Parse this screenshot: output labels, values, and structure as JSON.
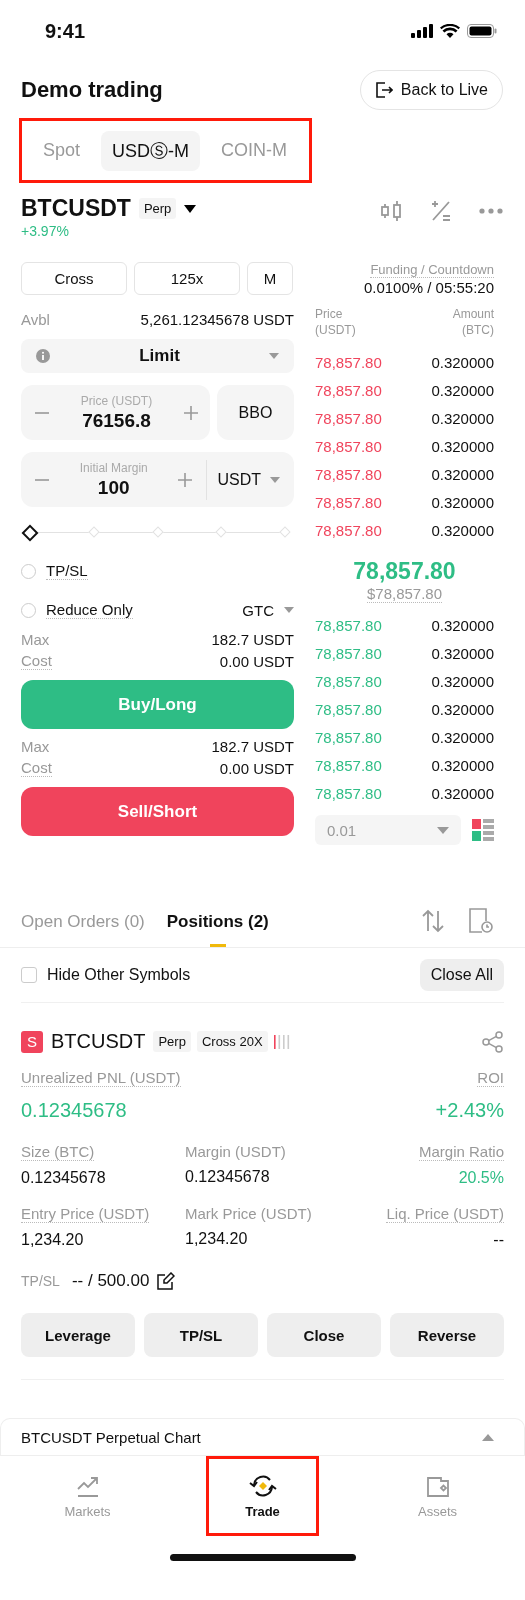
{
  "status_bar": {
    "time": "9:41"
  },
  "header": {
    "title": "Demo trading",
    "back_button": "Back to Live"
  },
  "market_tabs": {
    "highlighted": true,
    "items": [
      {
        "label": "Spot",
        "selected": false
      },
      {
        "label": "USDⓈ-M",
        "selected": true
      },
      {
        "label": "COIN-M",
        "selected": false
      }
    ]
  },
  "symbol": {
    "name": "BTCUSDT",
    "tag": "Perp",
    "change": "+3.97%"
  },
  "order_form": {
    "margin_mode": "Cross",
    "leverage": "125x",
    "asset_mode": "M",
    "avbl_label": "Avbl",
    "avbl_value": "5,261.12345678 USDT",
    "order_type": "Limit",
    "price_field": {
      "label": "Price (USDT)",
      "value": "76156.8"
    },
    "bbo": "BBO",
    "margin_field": {
      "label": "Initial Margin",
      "value": "100",
      "unit": "USDT"
    },
    "slider": {
      "level": 0
    },
    "options": [
      {
        "label": "TP/SL",
        "checked": false
      },
      {
        "label": "Reduce Only",
        "checked": false
      }
    ],
    "time_in_force": "GTC",
    "buy": {
      "max_label": "Max",
      "max_value": "182.7 USDT",
      "cost_label": "Cost",
      "cost_value": "0.00 USDT",
      "button": "Buy/Long"
    },
    "sell": {
      "max_label": "Max",
      "max_value": "182.7 USDT",
      "cost_label": "Cost",
      "cost_value": "0.00 USDT",
      "button": "Sell/Short"
    }
  },
  "order_book": {
    "funding_label": "Funding / Countdown",
    "funding_value": "0.0100% / 05:55:20",
    "price_header": "Price (USDT)",
    "amount_header": "Amount (BTC)",
    "asks": [
      {
        "price": "78,857.80",
        "amount": "0.320000"
      },
      {
        "price": "78,857.80",
        "amount": "0.320000"
      },
      {
        "price": "78,857.80",
        "amount": "0.320000"
      },
      {
        "price": "78,857.80",
        "amount": "0.320000"
      },
      {
        "price": "78,857.80",
        "amount": "0.320000"
      },
      {
        "price": "78,857.80",
        "amount": "0.320000"
      },
      {
        "price": "78,857.80",
        "amount": "0.320000"
      }
    ],
    "last_price": "78,857.80",
    "mark_price": "$78,857.80",
    "bids": [
      {
        "price": "78,857.80",
        "amount": "0.320000"
      },
      {
        "price": "78,857.80",
        "amount": "0.320000"
      },
      {
        "price": "78,857.80",
        "amount": "0.320000"
      },
      {
        "price": "78,857.80",
        "amount": "0.320000"
      },
      {
        "price": "78,857.80",
        "amount": "0.320000"
      },
      {
        "price": "78,857.80",
        "amount": "0.320000"
      },
      {
        "price": "78,857.80",
        "amount": "0.320000"
      }
    ],
    "depth": "0.01"
  },
  "orders_tabs": [
    {
      "label": "Open Orders (0)",
      "selected": false
    },
    {
      "label": "Positions (2)",
      "selected": true
    }
  ],
  "filter": {
    "label": "Hide Other Symbols",
    "checked": false,
    "close_all": "Close All"
  },
  "position": {
    "side": "S",
    "symbol": "BTCUSDT",
    "tags": [
      "Perp",
      "Cross 20X"
    ],
    "pnl_label": "Unrealized PNL (USDT)",
    "pnl_value": "0.12345678",
    "roi_label": "ROI",
    "roi_value": "+2.43%",
    "fields": [
      {
        "label": "Size (BTC)",
        "value": "0.12345678",
        "hint": true,
        "positive": false
      },
      {
        "label": "Margin (USDT)",
        "value": "0.12345678",
        "hint": false,
        "positive": false
      },
      {
        "label": "Margin Ratio",
        "value": "20.5%",
        "hint": true,
        "positive": true
      },
      {
        "label": "Entry Price (USDT)",
        "value": "1,234.20",
        "hint": true,
        "positive": false
      },
      {
        "label": "Mark Price (USDT)",
        "value": "1,234.20",
        "hint": false,
        "positive": false
      },
      {
        "label": "Liq. Price (USDT)",
        "value": "--",
        "hint": true,
        "positive": false
      }
    ],
    "tpsl_label": "TP/SL",
    "tpsl_value": "-- / 500.00",
    "actions": [
      "Leverage",
      "TP/SL",
      "Close",
      "Reverse"
    ]
  },
  "chart_bar": {
    "title": "BTCUSDT Perpetual Chart"
  },
  "nav": [
    {
      "label": "Markets",
      "selected": false,
      "highlighted": false,
      "kind": "markets"
    },
    {
      "label": "Trade",
      "selected": true,
      "highlighted": true,
      "kind": "trade"
    },
    {
      "label": "Assets",
      "selected": false,
      "highlighted": false,
      "kind": "assets"
    }
  ]
}
